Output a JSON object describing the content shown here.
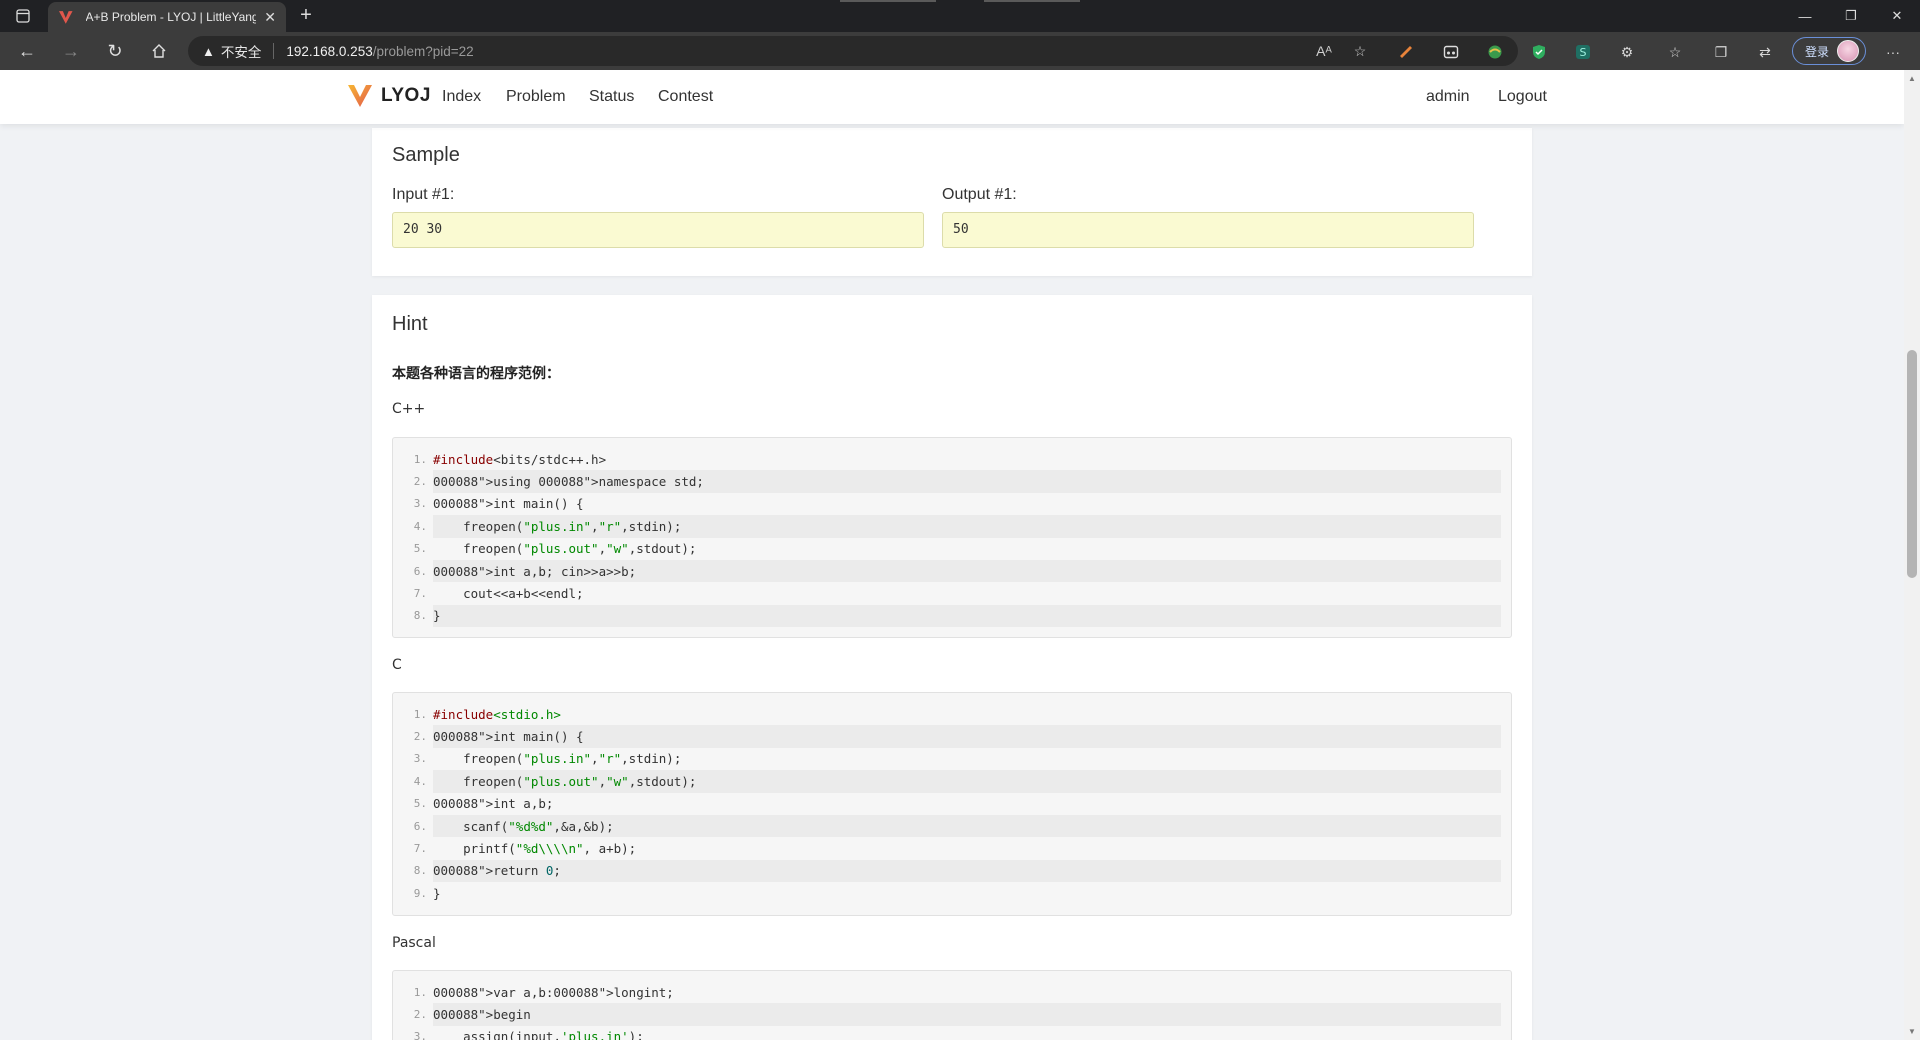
{
  "browser": {
    "tab_title": "A+B Problem - LYOJ | LittleYang",
    "url_warning": "不安全",
    "url_host": "192.168.0.253",
    "url_path": "/problem?pid=22",
    "profile_label": "登录"
  },
  "nav": {
    "brand": "LYOJ",
    "items": [
      "Index",
      "Problem",
      "Status",
      "Contest"
    ],
    "user": "admin",
    "logout": "Logout"
  },
  "sample": {
    "title": "Sample",
    "input_label": "Input #1:",
    "input_value": "20 30",
    "output_label": "Output #1:",
    "output_value": "50"
  },
  "hint": {
    "title": "Hint",
    "intro": "本题各种语言的程序范例：",
    "languages": [
      {
        "name": "C++",
        "lines": [
          "#include<bits/stdc++.h>",
          "using namespace std;",
          "int main() {",
          "    freopen(\"plus.in\",\"r\",stdin);",
          "    freopen(\"plus.out\",\"w\",stdout);",
          "    int a,b; cin>>a>>b;",
          "    cout<<a+b<<endl;",
          "}"
        ]
      },
      {
        "name": "C",
        "lines": [
          "#include<stdio.h>",
          "int main() {",
          "    freopen(\"plus.in\",\"r\",stdin);",
          "    freopen(\"plus.out\",\"w\",stdout);",
          "    int a,b;",
          "    scanf(\"%d%d\",&a,&b);",
          "    printf(\"%d\\\\\\\\n\", a+b);",
          "    return 0;",
          "}"
        ]
      },
      {
        "name": "Pascal",
        "lines": [
          "var a,b:longint;",
          "begin",
          "    assign(input,'plus.in');"
        ]
      }
    ]
  },
  "colors": {
    "sample_box": "#fafad2",
    "keyword": "#000088",
    "string": "#008800",
    "preproc": "#880000"
  }
}
